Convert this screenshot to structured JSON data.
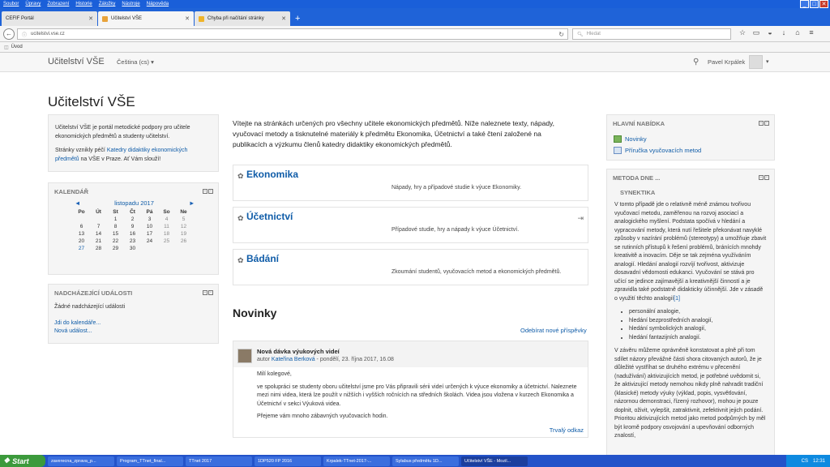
{
  "menubar": {
    "items": [
      "Soubor",
      "Úpravy",
      "Zobrazení",
      "Historie",
      "Záložky",
      "Nástroje",
      "Nápověda"
    ]
  },
  "tabs": [
    {
      "label": "CEFIF Portál"
    },
    {
      "label": "Učitelství VŠE"
    },
    {
      "label": "Chyba při načítání stránky"
    }
  ],
  "url": {
    "host": "ucitelstvi.vse.cz",
    "search_placeholder": "Hledat"
  },
  "bookmarks": {
    "item": "Úvod"
  },
  "site": {
    "brand": "Učitelství VŠE",
    "lang": "Čeština (cs)",
    "user": "Pavel Krpálek"
  },
  "page_title": "Učitelství VŠE",
  "about": {
    "p1": "Učitelství VŠE je portál metodické podpory pro učitele ekonomických předmětů a studenty učitelství.",
    "p2_pre": "Stránky vznikly péčí ",
    "p2_link": "Katedry didaktiky ekonomických předmětů",
    "p2_post": " na VŠE v Praze. Ať Vám slouží!"
  },
  "calendar": {
    "title": "KALENDÁŘ",
    "month": "listopadu 2017",
    "prev": "◄",
    "next": "►",
    "days": [
      "Po",
      "Út",
      "St",
      "Čt",
      "Pá",
      "So",
      "Ne"
    ],
    "cells": [
      "",
      "",
      "1",
      "2",
      "3",
      "4",
      "5",
      "6",
      "7",
      "8",
      "9",
      "10",
      "11",
      "12",
      "13",
      "14",
      "15",
      "16",
      "17",
      "18",
      "19",
      "20",
      "21",
      "22",
      "23",
      "24",
      "25",
      "26",
      "27",
      "28",
      "29",
      "30",
      "",
      "",
      ""
    ],
    "today": "27"
  },
  "events": {
    "title": "NADCHÁZEJÍCÍ UDÁLOSTI",
    "none": "Žádné nadcházející události",
    "goto": "Jdi do kalendáře...",
    "new": "Nová událost..."
  },
  "intro": "Vítejte na stránkách určených pro všechny učitele ekonomických předmětů. Níže naleznete texty, nápady, vyučovací metody a tisknutelné materiály k předmětu Ekonomika, Účetnictví a také čtení založené na publikacích a výzkumu členů katedry didaktiky ekonomických předmětů.",
  "courses": [
    {
      "name": "Ekonomika",
      "desc": "Nápady, hry a případové studie k výuce Ekonomiky."
    },
    {
      "name": "Účetnictví",
      "desc": "Případové studie, hry a nápady k výuce Účetnictví."
    },
    {
      "name": "Bádání",
      "desc": "Zkoumání studentů, vyučovacích metod a ekonomických předmětů."
    }
  ],
  "news": {
    "title": "Novinky",
    "subscribe": "Odebírat nové příspěvky",
    "post": {
      "subject": "Nová dávka výukových videí",
      "author_pre": "autor ",
      "author": "Kateřina Berková",
      "date": " - pondělí, 23. října 2017, 16.08",
      "greeting": "Milí kolegové,",
      "body": "ve spolupráci se studenty oboru učitelství jsme pro Vás připravili sérii videí určených k výuce ekonomiky a účetnictví. Naleznete mezi nimi videa, která lze použít v nižších i vyšších ročnících na středních školách. Videa jsou vložena v kurzech Ekonomika a Účetnictví v sekci Výuková videa.",
      "closing": "Přejeme vám mnoho zábavných vyučovacích hodin.",
      "permalink": "Trvalý odkaz"
    }
  },
  "mainmenu": {
    "title": "HLAVNÍ NABÍDKA",
    "items": [
      "Novinky",
      "Příručka vyučovacích metod"
    ]
  },
  "method": {
    "title": "METODA DNE ...",
    "name": "SYNEKTIKA",
    "p1": "V tomto případě jde o relativně méně známou tvořivou vyučovací metodu, zaměřenou na rozvoj asociací a analogického myšlení. Podstata spočívá v hledání a vypracování metody, která nutí řešitele překonávat navyklé způsoby v nazírání problémů (stereotypy) a umožňuje zbavit se rutinních přístupů k řešení problémů, bránících mnohdy kreativitě a inovacím. Děje se tak zejména využíváním analogií. Hledání analogií rozvíjí tvořivost, aktivizuje dosavadní vědomosti edukanci. Vyučování se stává pro učící se jedince zajímavější a kreativnější činností a je zpravidla také podstatně didakticky účinnější. Jde v zásadě o využití těchto analogií",
    "ref": "[1]",
    "list": [
      "personální analogie,",
      "hledání bezprostředních analogií,",
      "hledání symbolických analogií,",
      "hledání fantazijních analogií."
    ],
    "p2": "V závěru můžeme oprávněně konstatovat a plně při tom sdílet názory převážné části shora citovaných autorů, že je důležité vystříhat se druhého extrému v přecenění (nadužívání) aktivizujících metod, je potřebné uvědomit si, že aktivizující metody nemohou nikdy plně nahradit tradiční (klasické) metody výuky (výklad, popis, vysvětlování, názornou demonstraci, řízený rozhovor), mohou je pouze doplnit, oživit, vylepšit, zatraktivnit, zefektivnit jejich podání. Prioritou aktivizujících metod jako metod podpůrných by měl být kromě podpory osvojování a upevňování odborných znalostí,"
  },
  "taskbar": {
    "start": "Start",
    "tasks": [
      "zaverecna_zprava_p...",
      "Program_TTnet_final...",
      "TTnet 2017",
      "1DP520 FP 2016",
      "Krpalek-TTnet-2017-...",
      "Sylabus předmětu 1D...",
      "Učitelství VŠE - Mozil..."
    ],
    "lang": "CS",
    "clock": "12:31"
  }
}
